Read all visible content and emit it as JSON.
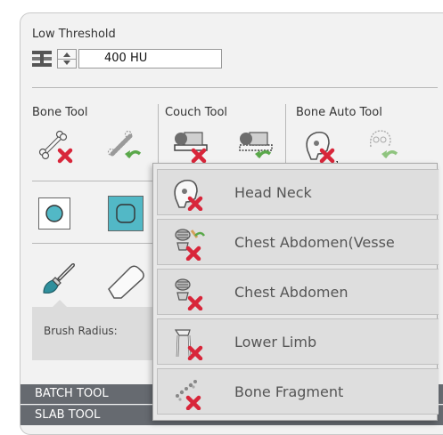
{
  "threshold": {
    "label": "Low Threshold",
    "value": "400 HU"
  },
  "tool_groups": {
    "bone_tool": "Bone Tool",
    "couch_tool": "Couch Tool",
    "bone_auto_tool": "Bone Auto Tool"
  },
  "brush": {
    "radius_label": "Brush Radius:"
  },
  "bottom_bars": {
    "batch": "BATCH TOOL",
    "slab": "SLAB TOOL"
  },
  "dropdown": {
    "items": [
      {
        "label": "Head Neck",
        "icon": "head-neck-remove-icon"
      },
      {
        "label": "Chest Abdomen(Vesse",
        "icon": "chest-abdomen-vessel-remove-icon"
      },
      {
        "label": "Chest Abdomen",
        "icon": "chest-abdomen-remove-icon"
      },
      {
        "label": "Lower Limb",
        "icon": "lower-limb-remove-icon"
      },
      {
        "label": "Bone Fragment",
        "icon": "bone-fragment-remove-icon"
      }
    ]
  },
  "colors": {
    "accent_teal": "#52b8c6",
    "remove_red": "#d8263a",
    "undo_green": "#5aa84a",
    "bar_gray": "#666a70"
  }
}
